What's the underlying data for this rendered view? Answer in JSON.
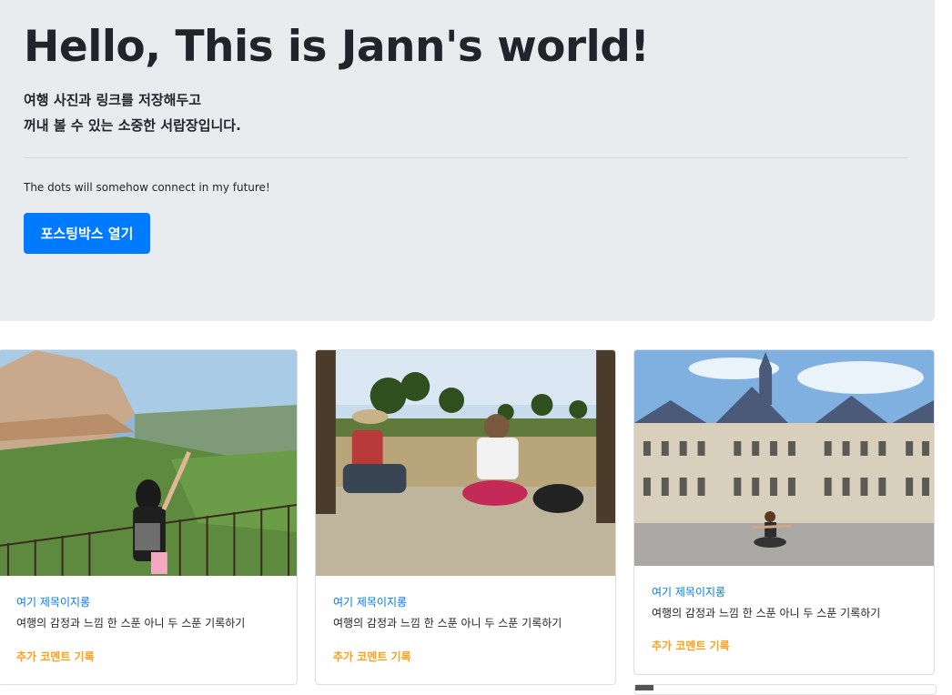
{
  "hero": {
    "title": "Hello, This is Jann's world!",
    "lead_line1": "여행 사진과 링크를 저장해두고",
    "lead_line2": "꺼내 볼 수 있는 소중한 서랍장입니다.",
    "tagline": "The dots will somehow connect in my future!",
    "button_label": "포스팅박스 열기"
  },
  "cards": [
    {
      "photo": "montserrat-mountain-photo",
      "title": "여기 제목이지롱",
      "text": "여행의 감정과 느낌 한 스푼 아니 두 스푼 기록하기",
      "link": "추가 코멘트 기록"
    },
    {
      "photo": "park-sitting-photo",
      "title": "여기 제목이지롱",
      "text": "여행의 감정과 느낌 한 스푼 아니 두 스푼 기록하기",
      "link": "추가 코멘트 기록"
    },
    {
      "photo": "paris-city-hall-photo",
      "title": "여기 제목이지롱",
      "text": "여행의 감정과 느낌 한 스푼 아니 두 스푼 기록하기",
      "link": "추가 코멘트 기록"
    }
  ],
  "colors": {
    "hero_bg": "#e9ecef",
    "primary": "#007bff",
    "link_orange": "#ff9f1a"
  }
}
